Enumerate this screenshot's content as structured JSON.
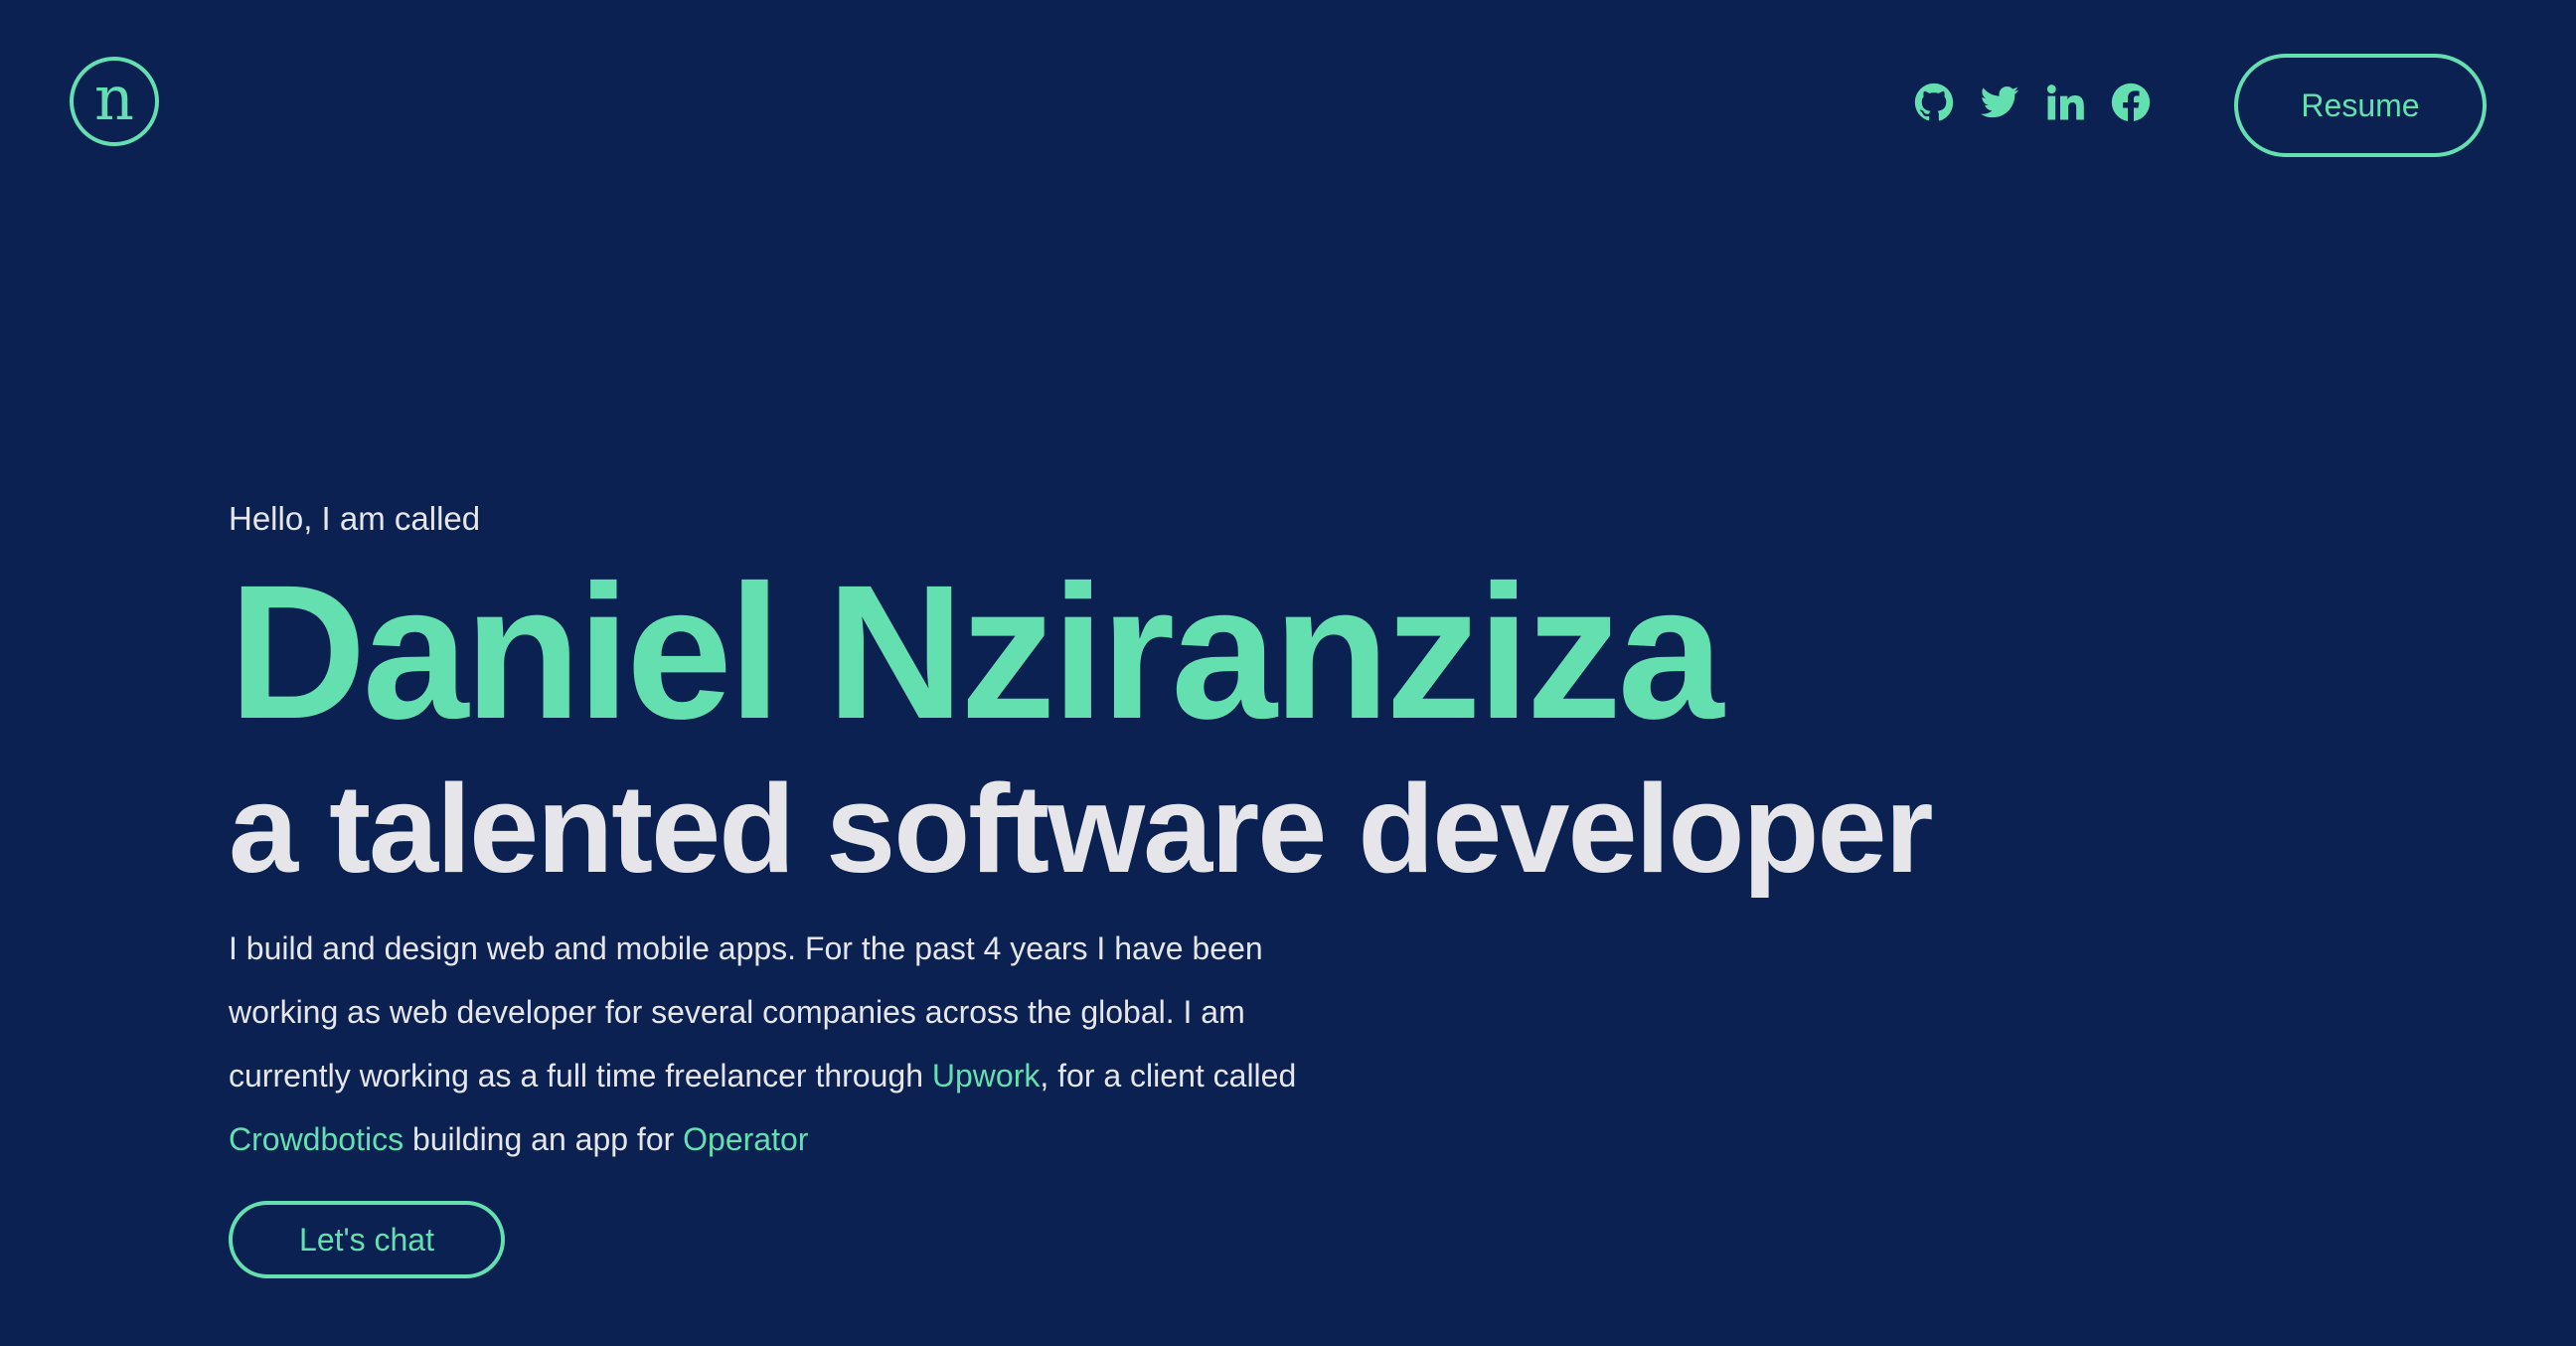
{
  "header": {
    "logo_letter": "n",
    "socials": [
      {
        "name": "github-icon"
      },
      {
        "name": "twitter-icon"
      },
      {
        "name": "linkedin-icon"
      },
      {
        "name": "facebook-icon"
      }
    ],
    "resume_label": "Resume"
  },
  "hero": {
    "greeting": "Hello, I am called",
    "name": "Daniel Nziranziza",
    "tagline": "a talented software developer",
    "bio": {
      "part1": "I build and design web and mobile apps. For the past 4 years I have been working as web developer for several companies across the global. I am currently working as a full time freelancer through ",
      "link1": "Upwork",
      "part2": ", for a client called ",
      "link2": "Crowdbotics",
      "part3": " building an app for ",
      "link3": "Operator"
    },
    "cta_label": "Let's chat"
  },
  "colors": {
    "background": "#0a2151",
    "accent": "#64e0b0",
    "text": "#e6e6ea"
  }
}
